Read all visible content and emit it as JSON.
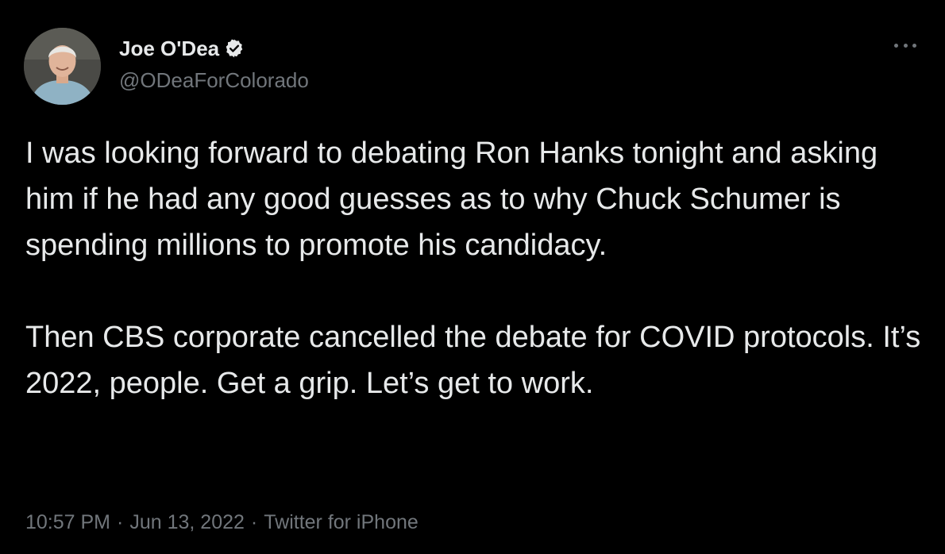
{
  "author": {
    "display_name": "Joe O'Dea",
    "handle": "@ODeaForColorado",
    "verified_icon": "verified-badge-icon",
    "avatar_icon": "avatar"
  },
  "tweet": {
    "text": "I was looking forward to debating Ron Hanks tonight and asking him if he had any good guesses as to why Chuck Schumer is spending millions to promote his candidacy.\n\nThen CBS corporate cancelled the debate for COVID protocols. It’s 2022, people. Get a grip. Let’s get to work.",
    "time": "10:57 PM",
    "separator": "·",
    "date": "Jun 13, 2022",
    "source": "Twitter for iPhone"
  },
  "menu": {
    "icon": "more-options-icon"
  },
  "colors": {
    "background": "#000000",
    "primary_text": "#e7e9ea",
    "secondary_text": "#71767b"
  }
}
